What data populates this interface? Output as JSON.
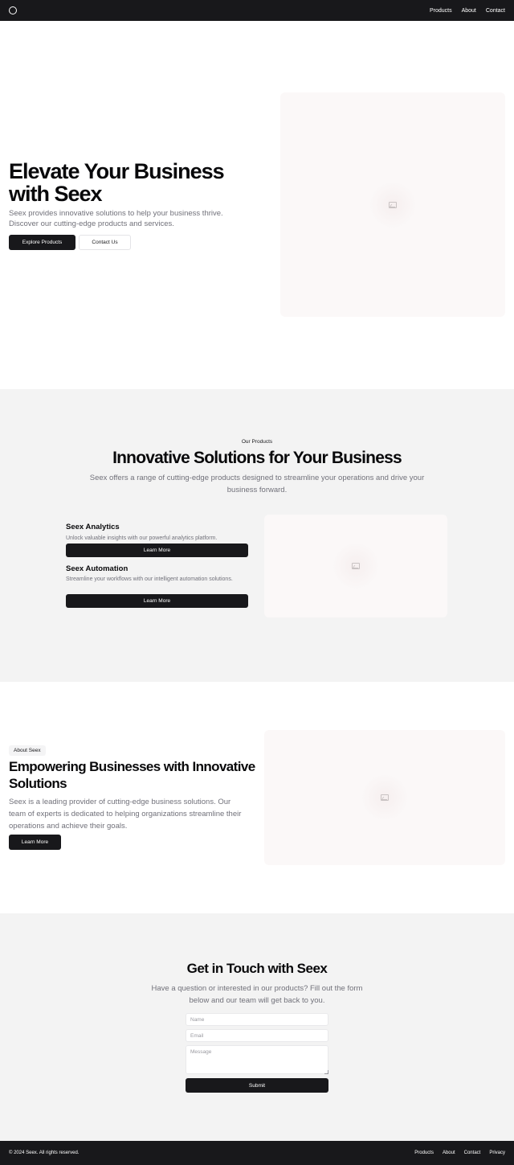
{
  "header": {
    "logo_icon": "circle-logo-icon",
    "nav": [
      "Products",
      "About",
      "Contact"
    ]
  },
  "hero": {
    "title": "Elevate Your Business with Seex",
    "subtitle": "Seex provides innovative solutions to help your business thrive. Discover our cutting-edge products and services.",
    "primary_button": "Explore Products",
    "secondary_button": "Contact Us",
    "image_icon": "image-placeholder-icon"
  },
  "products": {
    "eyebrow": "Our Products",
    "title": "Innovative Solutions for Your Business",
    "subtitle": "Seex offers a range of cutting-edge products designed to streamline your operations and drive your business forward.",
    "items": [
      {
        "name": "Seex Analytics",
        "description": "Unlock valuable insights with our powerful analytics platform.",
        "button": "Learn More"
      },
      {
        "name": "Seex Automation",
        "description": "Streamline your workflows with our intelligent automation solutions.",
        "button": "Learn More"
      }
    ]
  },
  "about": {
    "badge": "About Seex",
    "title": "Empowering Businesses with Innovative Solutions",
    "text": "Seex is a leading provider of cutting-edge business solutions. Our team of experts is dedicated to helping organizations streamline their operations and achieve their goals.",
    "button": "Learn More"
  },
  "contact": {
    "title": "Get in Touch with Seex",
    "subtitle": "Have a question or interested in our products? Fill out the form below and our team will get back to you.",
    "name_placeholder": "Name",
    "email_placeholder": "Email",
    "message_placeholder": "Message",
    "submit": "Submit"
  },
  "footer": {
    "copyright": "© 2024 Seex. All rights reserved.",
    "nav": [
      "Products",
      "About",
      "Contact",
      "Privacy"
    ]
  },
  "colors": {
    "dark": "#18181b",
    "muted_text": "#71717a",
    "section_bg": "#f3f3f3",
    "placeholder_bg": "#fbf8f8"
  }
}
